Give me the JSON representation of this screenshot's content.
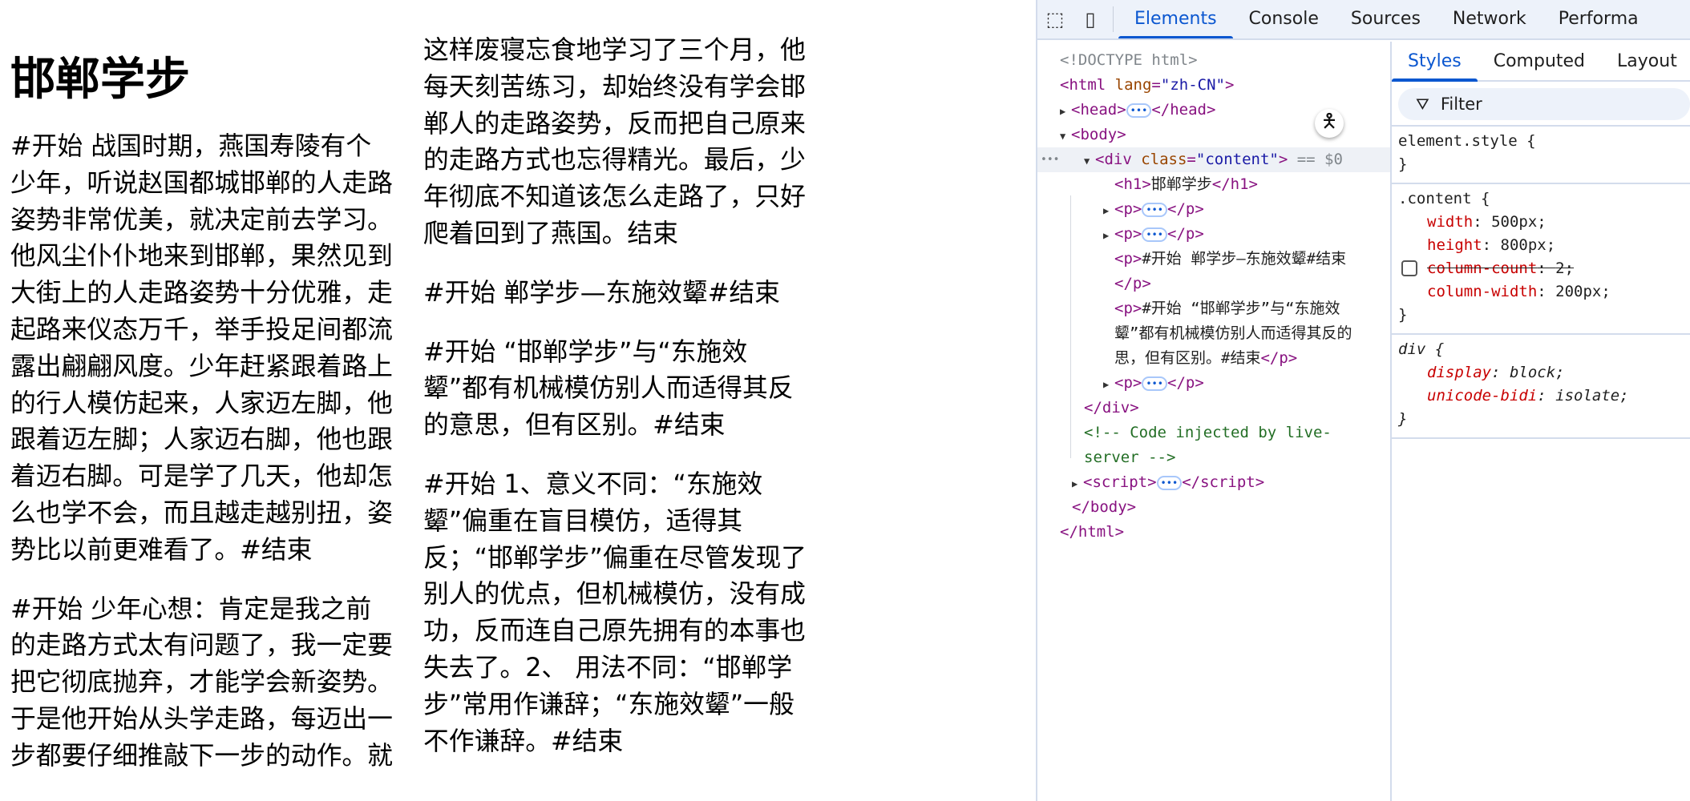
{
  "page": {
    "title": "邯郸学步",
    "paragraphs": [
      "#开始 战国时期，燕国寿陵有个少年，听说赵国都城邯郸的人走路姿势非常优美，就决定前去学习。他风尘仆仆地来到邯郸，果然见到大街上的人走路姿势十分优雅，走起路来仪态万千，举手投足间都流露出翩翩风度。少年赶紧跟着路上的行人模仿起来，人家迈左脚，他跟着迈左脚；人家迈右脚，他也跟着迈右脚。可是学了几天，他却怎么也学不会，而且越走越别扭，姿势比以前更难看了。#结束",
      "#开始 少年心想：肯定是我之前的走路方式太有问题了，我一定要把它彻底抛弃，才能学会新姿势。于是他开始从头学走路，每迈出一步都要仔细推敲下一步的动作。就这样废寝忘食地学习了三个月，他每天刻苦练习，却始终没有学会邯郸人的走路姿势，反而把自己原来的走路方式也忘得精光。最后，少年彻底不知道该怎么走路了，只好爬着回到了燕国。结束",
      "#开始 郸学步—东施效颦#结束",
      "#开始 “邯郸学步”与“东施效颦”都有机械模仿别人而适得其反的意思，但有区别。#结束",
      "#开始 1、意义不同：“东施效颦”偏重在盲目模仿，适得其反；“邯郸学步”偏重在尽管发现了别人的优点，但机械模仿，没有成功，反而连自己原先拥有的本事也失去了。2、 用法不同：“邯郸学步”常用作谦辞；“东施效颦”一般不作谦辞。#结束"
    ]
  },
  "devtools": {
    "tabs": [
      "Elements",
      "Console",
      "Sources",
      "Network",
      "Performa"
    ],
    "active_tab": "Elements",
    "icons": [
      "inspect-element-icon",
      "device-toolbar-icon",
      "accessibility-icon",
      "filter-icon"
    ],
    "dom": {
      "doctype": "<!DOCTYPE html>",
      "html_open": "<html",
      "lang_attr": "lang",
      "lang_val": "\"zh-CN\"",
      "gt": ">",
      "head_open": "<head>",
      "head_close": "</head>",
      "body_open": "<body>",
      "div_open": "<div",
      "class_attr": "class",
      "class_val": "\"content\"",
      "eq": "=",
      "sel_marker": "== $0",
      "h1_open": "<h1>",
      "h1_text": "邯郸学步",
      "h1_close": "</h1>",
      "p_open": "<p>",
      "p_close": "</p>",
      "p3_text": "#开始 郸学步—东施效颦#结束",
      "p4_text_1": "#开始 “邯郸学步”与“东施效",
      "p4_text_2": "颦”都有机械模仿别人而适得其反的",
      "p4_text_3": "思，但有区别。#结束",
      "div_close": "</div>",
      "comment_1": "<!-- Code injected by live-",
      "comment_2": "server -->",
      "script_open": "<script>",
      "script_close": "</script>",
      "body_close": "</body>",
      "html_close": "</html>",
      "ellipsis": "•••",
      "row_menu": "•••"
    },
    "styles": {
      "subtabs": [
        "Styles",
        "Computed",
        "Layout"
      ],
      "active_subtab": "Styles",
      "filter_placeholder": "Filter",
      "element_style": "element.style {",
      "close_brace": "}",
      "content_selector": ".content {",
      "content_props": [
        {
          "name": "width",
          "value": "500px;"
        },
        {
          "name": "height",
          "value": "800px;"
        },
        {
          "name": "column-count",
          "value": "2;",
          "disabled": true
        },
        {
          "name": "column-width",
          "value": "200px;"
        }
      ],
      "div_selector": "div {",
      "div_props": [
        {
          "name": "display",
          "value": "block;"
        },
        {
          "name": "unicode-bidi",
          "value": "isolate;"
        }
      ]
    }
  }
}
